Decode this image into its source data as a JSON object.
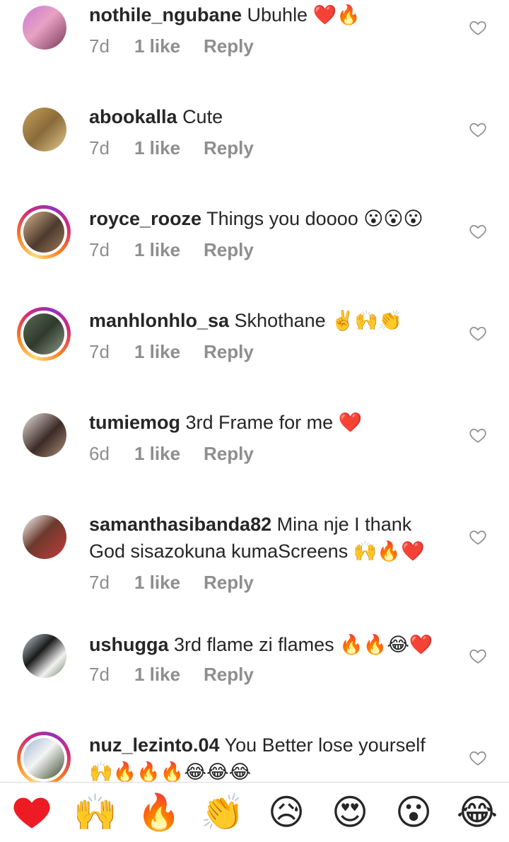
{
  "comments": [
    {
      "username": "nothile_ngubane",
      "text": "Ubuhle",
      "emoji": "❤️🔥",
      "time": "7d",
      "likes": "1 like",
      "reply": "Reply"
    },
    {
      "username": "abookalla",
      "text": "Cute",
      "emoji": "",
      "time": "7d",
      "likes": "1 like",
      "reply": "Reply"
    },
    {
      "username": "royce_rooze",
      "text": "Things you doooo",
      "emoji": "😮😮😮",
      "time": "7d",
      "likes": "1 like",
      "reply": "Reply"
    },
    {
      "username": "manhlonhlo_sa",
      "text": "Skhothane",
      "emoji": "✌️🙌👏",
      "time": "7d",
      "likes": "1 like",
      "reply": "Reply"
    },
    {
      "username": "tumiemog",
      "text": "3rd Frame for me",
      "emoji": "❤️",
      "time": "6d",
      "likes": "1 like",
      "reply": "Reply"
    },
    {
      "username": "samanthasibanda82",
      "text": "Mina nje I thank God  sisazokuna kumaScreens",
      "emoji": "🙌🔥❤️",
      "time": "7d",
      "likes": "1 like",
      "reply": "Reply"
    },
    {
      "username": "ushugga",
      "text": "3rd flame zi flames",
      "emoji": "🔥🔥😂❤️",
      "time": "7d",
      "likes": "1 like",
      "reply": "Reply"
    },
    {
      "username": "nuz_lezinto.04",
      "text": "You Better lose yourself",
      "emoji": "🙌🔥🔥🔥😂😂😂",
      "time": "",
      "likes": "",
      "reply": ""
    }
  ],
  "emoji_bar": [
    {
      "icon": "red-heart-icon",
      "glyph": "❤️"
    },
    {
      "icon": "raising-hands-icon",
      "glyph": "🙌"
    },
    {
      "icon": "fire-icon",
      "glyph": "🔥"
    },
    {
      "icon": "clapping-hands-icon",
      "glyph": "👏"
    },
    {
      "icon": "sad-face-icon",
      "glyph": "😥"
    },
    {
      "icon": "heart-eyes-icon",
      "glyph": "😍"
    },
    {
      "icon": "surprised-face-icon",
      "glyph": "😮"
    },
    {
      "icon": "tears-of-joy-icon",
      "glyph": "😂"
    }
  ],
  "colors": {
    "text": "#262626",
    "meta": "#8e8e8e",
    "heart": "#ed1c24",
    "story_ring": "#d62976"
  }
}
